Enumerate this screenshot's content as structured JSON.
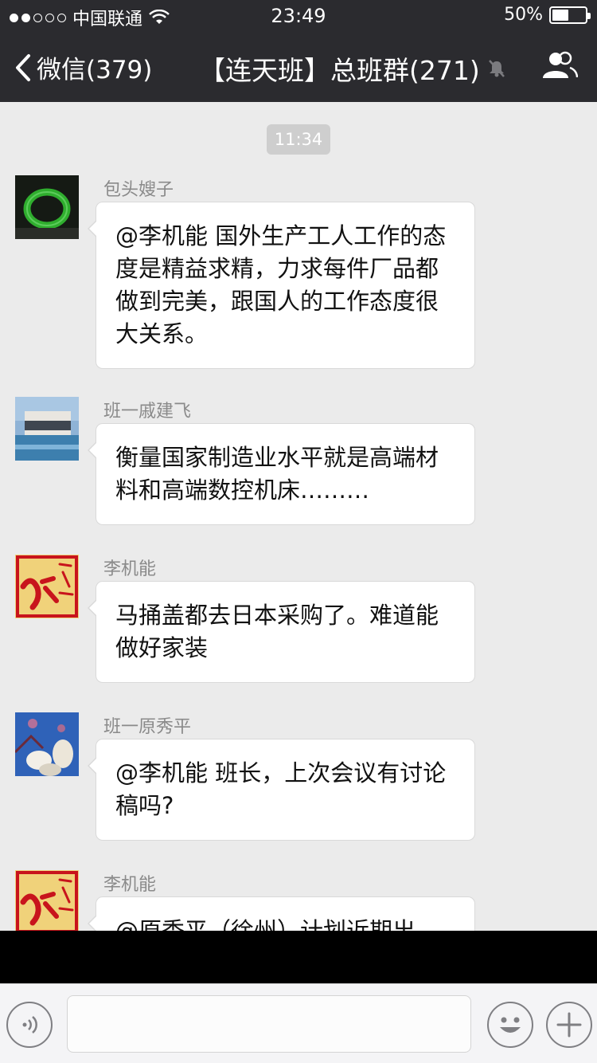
{
  "status_bar": {
    "carrier": "中国联通",
    "time": "23:49",
    "battery_percent_label": "50%",
    "battery_level": 0.5,
    "signal_dots_filled": 2,
    "signal_dots_total": 5
  },
  "nav": {
    "back_label": "微信(379)",
    "title": "【连天班】总班群(271)",
    "muted": true
  },
  "chat": {
    "timestamp": "11:34",
    "messages": [
      {
        "sender": "包头嫂子",
        "text": "@李机能 国外生产工人工作的态度是精益求精，力求每件厂品都做到完美，跟国人的工作态度很大关系。",
        "avatar": "jade-bangle"
      },
      {
        "sender": "班一戚建飞",
        "text": "衡量国家制造业水平就是高端材料和高端数控机床………",
        "avatar": "modern-house"
      },
      {
        "sender": "李机能",
        "text": "马捅盖都去日本采购了。难道能做好家装",
        "avatar": "red-calligraphy"
      },
      {
        "sender": "班一原秀平",
        "text": "@李机能 班长，上次会议有讨论稿吗?",
        "avatar": "magnolia-flower"
      },
      {
        "sender": "李机能",
        "text": "@原秀平（徐州）计划近期出",
        "avatar": "red-calligraphy"
      }
    ]
  },
  "input_bar": {
    "placeholder": "",
    "icons": [
      "voice-icon",
      "emoji-icon",
      "plus-icon"
    ]
  },
  "colors": {
    "nav_bg": "#2b2b2f",
    "chat_bg": "#ebebeb",
    "bubble_bg": "#ffffff",
    "accent_red": "#c8141c"
  }
}
